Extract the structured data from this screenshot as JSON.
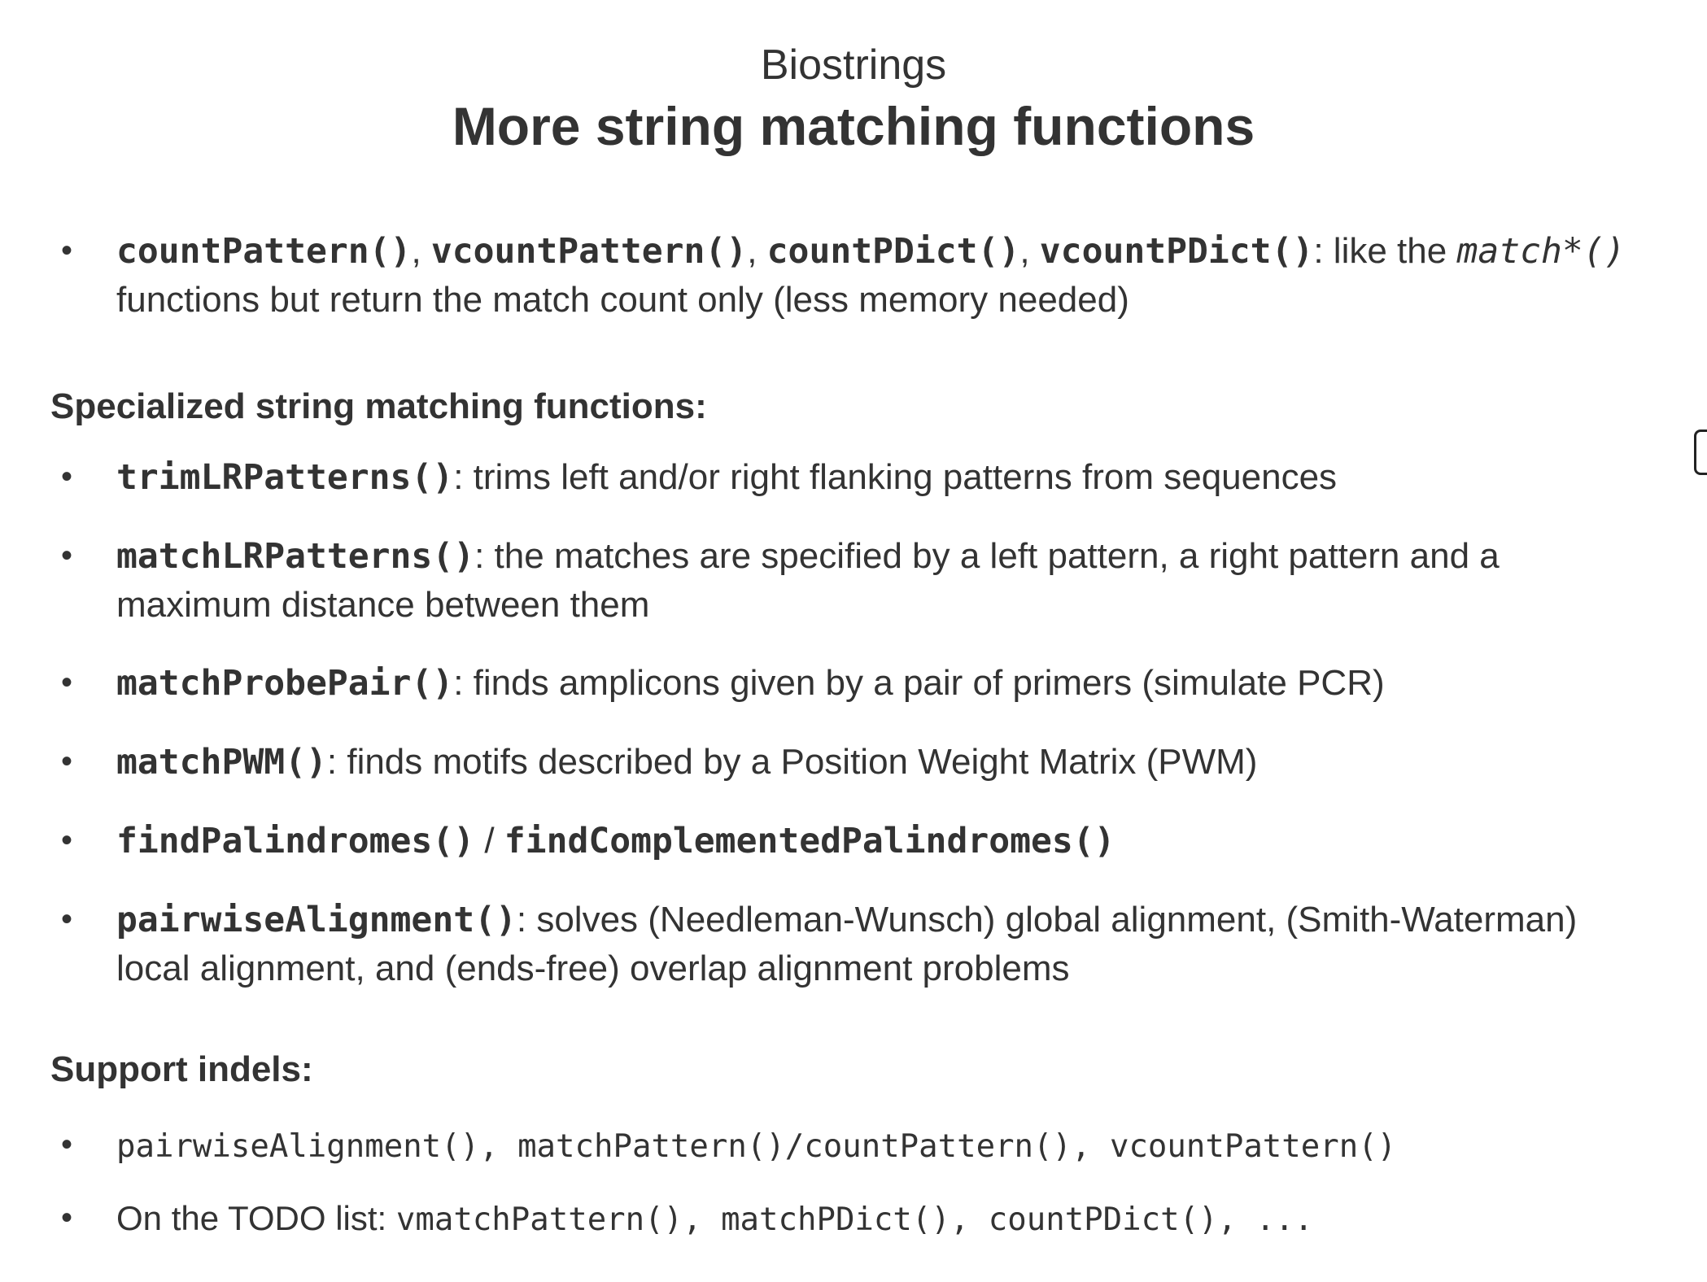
{
  "header": {
    "subtitle": "Biostrings",
    "title": "More string matching functions"
  },
  "intro": {
    "fn1": "countPattern()",
    "sep1": ", ",
    "fn2": "vcountPattern()",
    "sep2": ", ",
    "fn3": "countPDict()",
    "sep3": ", ",
    "fn4": "vcountPDict()",
    "text1": ": like the ",
    "fn5": "match*()",
    "text2": " functions but return the match count only (less memory needed)"
  },
  "specialized": {
    "heading": "Specialized string matching functions:",
    "items": [
      {
        "fn": "trimLRPatterns()",
        "text": ": trims left and/or right flanking patterns from sequences"
      },
      {
        "fn": "matchLRPatterns()",
        "text": ": the matches are specified by a left pattern, a right pattern and a maximum distance between them"
      },
      {
        "fn": "matchProbePair()",
        "text": ": finds amplicons given by a pair of primers (simulate PCR)"
      },
      {
        "fn": "matchPWM()",
        "text": ": finds motifs described by a Position Weight Matrix (PWM)"
      },
      {
        "fn": "findPalindromes()",
        "text": " / ",
        "fn2": "findComplementedPalindromes()"
      },
      {
        "fn": "pairwiseAlignment()",
        "text": ": solves (Needleman-Wunsch) global alignment, (Smith-Waterman) local alignment, and (ends-free) overlap alignment problems"
      }
    ]
  },
  "indels": {
    "heading": "Support indels:",
    "items": [
      {
        "code": "pairwiseAlignment(), matchPattern()/countPattern(), vcountPattern()"
      },
      {
        "text": "On the TODO list: ",
        "code": "vmatchPattern(), matchPDict(), countPDict(), ..."
      }
    ]
  }
}
